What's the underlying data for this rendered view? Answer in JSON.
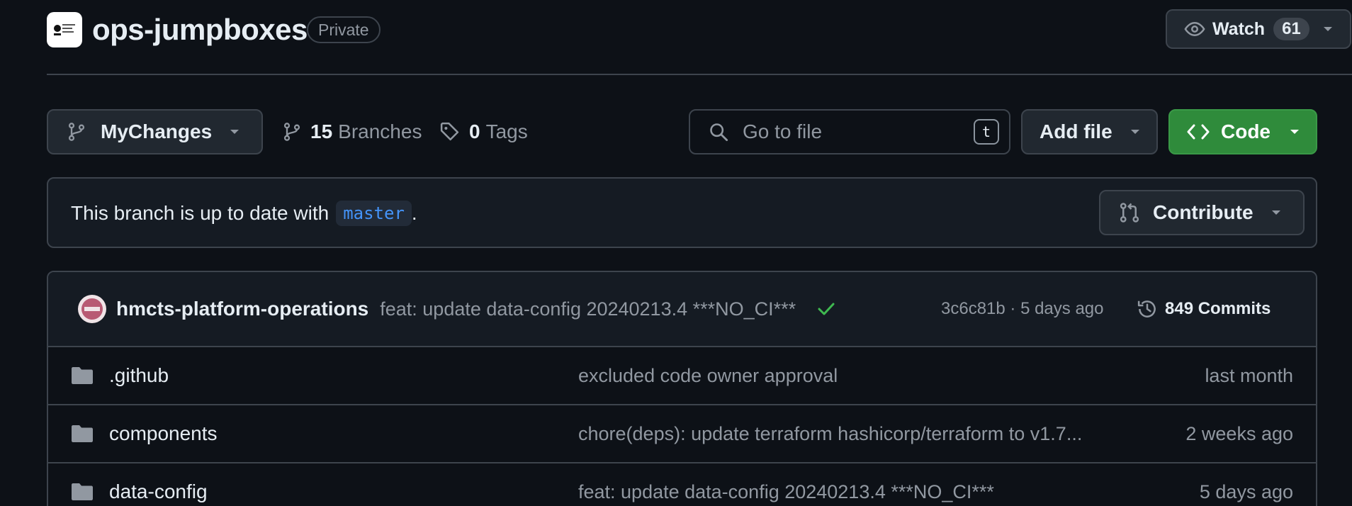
{
  "repo": {
    "name": "ops-jumpboxes",
    "visibility": "Private",
    "watch_label": "Watch",
    "watch_count": "61"
  },
  "toolbar": {
    "branch_name": "MyChanges",
    "branches_count": "15",
    "branches_label": "Branches",
    "tags_count": "0",
    "tags_label": "Tags",
    "search_placeholder": "Go to file",
    "search_shortcut": "t",
    "add_file_label": "Add file",
    "code_label": "Code"
  },
  "branch_status": {
    "text": "This branch is up to date with",
    "base_branch": "master",
    "suffix": ".",
    "contribute_label": "Contribute"
  },
  "latest_commit": {
    "author": "hmcts-platform-operations",
    "message": "feat: update data-config 20240213.4 ***NO_CI***",
    "hash_and_time": "3c6c81b · 5 days ago",
    "commits_label": "849 Commits"
  },
  "files": [
    {
      "name": ".github",
      "message": "excluded code owner approval",
      "date": "last month"
    },
    {
      "name": "components",
      "message": "chore(deps): update terraform hashicorp/terraform to v1.7...",
      "date": "2 weeks ago"
    },
    {
      "name": "data-config",
      "message": "feat: update data-config 20240213.4 ***NO_CI***",
      "date": "5 days ago"
    }
  ],
  "colors": {
    "background": "#0d1117",
    "code_button": "#2f8b3b",
    "accent_link": "#4493f8",
    "check": "#3fb950"
  },
  "icons": {
    "watch": "eye-icon",
    "branch": "git-branch-icon",
    "tag": "tag-icon",
    "search": "search-icon",
    "code": "code-icon",
    "contribute": "git-pull-request-icon",
    "history": "history-icon",
    "folder": "folder-icon",
    "check": "check-icon"
  }
}
